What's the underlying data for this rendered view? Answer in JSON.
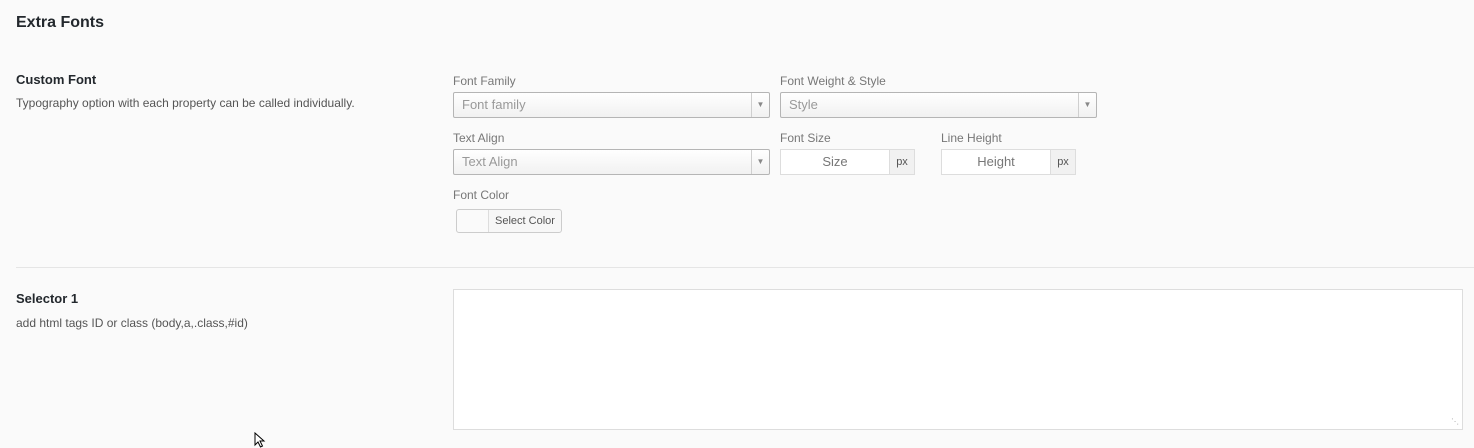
{
  "section": {
    "title": "Extra Fonts"
  },
  "custom_font": {
    "title": "Custom Font",
    "description": "Typography option with each property can be called individually.",
    "font_family": {
      "label": "Font Family",
      "placeholder": "Font family"
    },
    "font_weight_style": {
      "label": "Font Weight & Style",
      "placeholder": "Style"
    },
    "text_align": {
      "label": "Text Align",
      "placeholder": "Text Align"
    },
    "font_size": {
      "label": "Font Size",
      "placeholder": "Size",
      "unit": "px"
    },
    "line_height": {
      "label": "Line Height",
      "placeholder": "Height",
      "unit": "px"
    },
    "font_color": {
      "label": "Font Color",
      "button_label": "Select Color"
    }
  },
  "selector_1": {
    "title": "Selector 1",
    "description": "add html tags ID or class (body,a,.class,#id)",
    "value": ""
  },
  "icons": {
    "dropdown": "chevron-down-icon",
    "resize": "resize-handle-icon",
    "cursor": "mouse-pointer-icon"
  }
}
